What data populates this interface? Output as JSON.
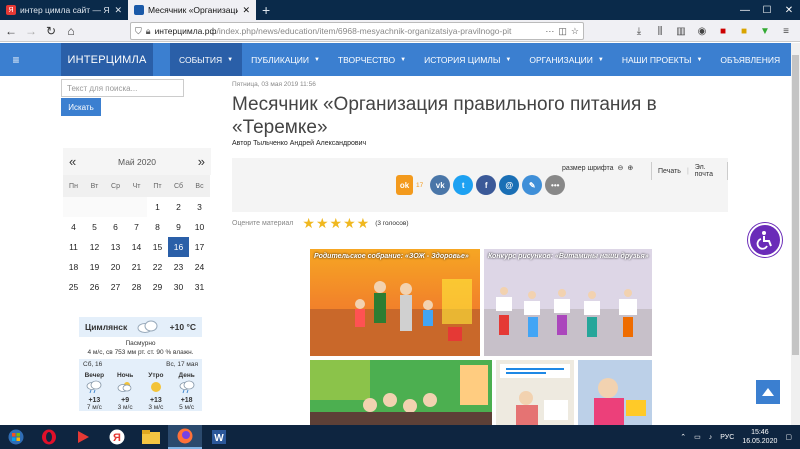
{
  "browser": {
    "tabs": [
      {
        "title": "интер цимла сайт — Яндекс: н",
        "favicon_color": "#e53935",
        "active": false
      },
      {
        "title": "Месячник «Организация прав",
        "favicon_color": "#1b5aa8",
        "active": true
      }
    ],
    "url_host": "интерцимла.рф",
    "url_path": "/index.php/news/education/item/6968-mesyachnik-organizatsiya-pravilnogo-pit",
    "url_more": "···"
  },
  "site": {
    "logo": "ИНТЕРЦИМЛА",
    "menu": [
      {
        "label": "СОБЫТИЯ",
        "has_caret": true,
        "active": true
      },
      {
        "label": "ПУБЛИКАЦИИ",
        "has_caret": true
      },
      {
        "label": "ТВОРЧЕСТВО",
        "has_caret": true
      },
      {
        "label": "ИСТОРИЯ ЦИМЛЫ",
        "has_caret": true
      },
      {
        "label": "ОРГАНИЗАЦИИ",
        "has_caret": true
      },
      {
        "label": "НАШИ ПРОЕКТЫ",
        "has_caret": true
      },
      {
        "label": "ОБЪЯВЛЕНИЯ",
        "has_caret": false
      }
    ],
    "accent": "#3b7fd0",
    "accent_dark": "#2a5fa8"
  },
  "sidebar": {
    "search_placeholder": "Текст для поиска...",
    "search_button": "Искать",
    "calendar": {
      "prev": "«",
      "next": "»",
      "month": "Май 2020",
      "weekdays": [
        "Пн",
        "Вт",
        "Ср",
        "Чт",
        "Пт",
        "Сб",
        "Вс"
      ],
      "weeks": [
        [
          "",
          "",
          "",
          "",
          "1",
          "2",
          "3"
        ],
        [
          "4",
          "5",
          "6",
          "7",
          "8",
          "9",
          "10"
        ],
        [
          "11",
          "12",
          "13",
          "14",
          "15",
          "16",
          "17"
        ],
        [
          "18",
          "19",
          "20",
          "21",
          "22",
          "23",
          "24"
        ],
        [
          "25",
          "26",
          "27",
          "28",
          "29",
          "30",
          "31"
        ]
      ],
      "today": "16"
    },
    "weather": {
      "city": "Цимлянск",
      "temp": "+10 °C",
      "desc": "Пасмурно",
      "details": "4 м/с, св   753 мм рт. ст.   90 % влажн.",
      "day1": "Сб, 16",
      "day2": "Вс, 17 мая",
      "periods": [
        {
          "label": "Вечер",
          "icon": "cloud-rain-icon",
          "temp": "+13",
          "wind": "7 м/с"
        },
        {
          "label": "Ночь",
          "icon": "cloud-icon",
          "temp": "+9",
          "wind": "3 м/с"
        },
        {
          "label": "Утро",
          "icon": "sun-icon",
          "temp": "+13",
          "wind": "3 м/с"
        },
        {
          "label": "День",
          "icon": "cloud-rain-icon",
          "temp": "+18",
          "wind": "5 м/с"
        }
      ]
    }
  },
  "article": {
    "date": "Пятница, 03 мая 2019 11:56",
    "title": "Месячник «Организация правильного питания в «Теремке»",
    "author": "Автор Тыльченко Андрей Александрович",
    "font_size_label": "размер шрифта",
    "print_label": "Печать",
    "email_label": "Эл. почта",
    "ok_count": "17",
    "rating_label": "Оцените материал",
    "rating_value": 5,
    "rating_votes": "(3 голосов)",
    "photo_captions": [
      "Родительское собрание: «ЗОЖ - Здоровье»",
      "Конкурс рисунков: «Витамины наши друзья»"
    ]
  },
  "taskbar": {
    "lang": "РУС",
    "time": "15:46",
    "date": "16.05.2020"
  }
}
